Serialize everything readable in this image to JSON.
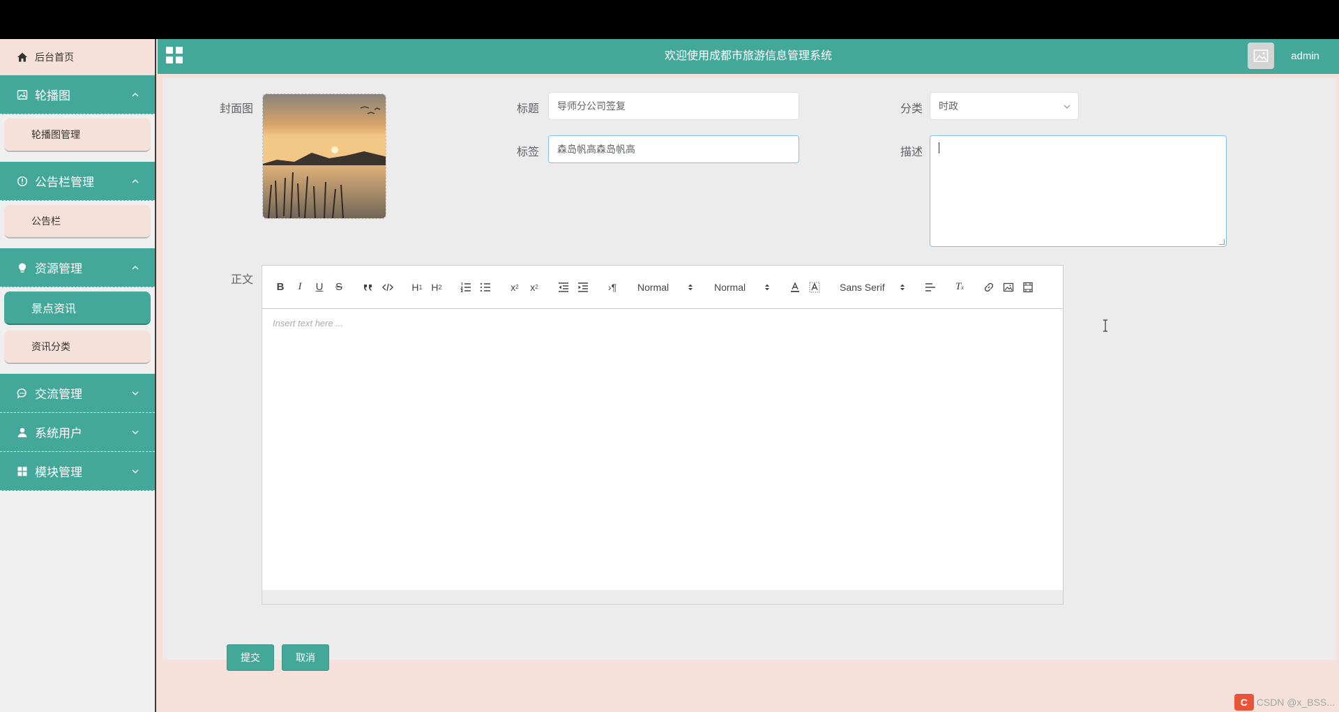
{
  "header": {
    "title": "欢迎使用成都市旅游信息管理系统",
    "username": "admin"
  },
  "sidebar": {
    "home_label": "后台首页",
    "groups": [
      {
        "label": "轮播图",
        "expanded": true,
        "icon": "image-icon",
        "items": [
          {
            "label": "轮播图管理",
            "active": false
          }
        ]
      },
      {
        "label": "公告栏管理",
        "expanded": true,
        "icon": "info-circle-icon",
        "items": [
          {
            "label": "公告栏",
            "active": false
          }
        ]
      },
      {
        "label": "资源管理",
        "expanded": true,
        "icon": "lightbulb-icon",
        "items": [
          {
            "label": "景点资讯",
            "active": true
          },
          {
            "label": "资讯分类",
            "active": false
          }
        ]
      },
      {
        "label": "交流管理",
        "expanded": false,
        "icon": "chat-icon",
        "items": []
      },
      {
        "label": "系统用户",
        "expanded": false,
        "icon": "user-icon",
        "items": []
      },
      {
        "label": "模块管理",
        "expanded": false,
        "icon": "grid-icon",
        "items": []
      }
    ]
  },
  "form": {
    "cover_label": "封面图",
    "title_label": "标题",
    "title_value": "导师分公司签复",
    "category_label": "分类",
    "category_value": "时政",
    "tag_label": "标签",
    "tag_value": "森岛帆高森岛帆高",
    "description_label": "描述",
    "description_value": "",
    "body_label": "正文",
    "editor_placeholder": "Insert text here ...",
    "editor_selects": {
      "header": "Normal",
      "size": "Normal",
      "font": "Sans Serif"
    },
    "submit_label": "提交",
    "cancel_label": "取消"
  },
  "watermark": "CSDN @x_BSS...",
  "colors": {
    "primary": "#43a89a",
    "sidebar_item_bg": "#f6e1da",
    "content_bg": "#ececec"
  }
}
